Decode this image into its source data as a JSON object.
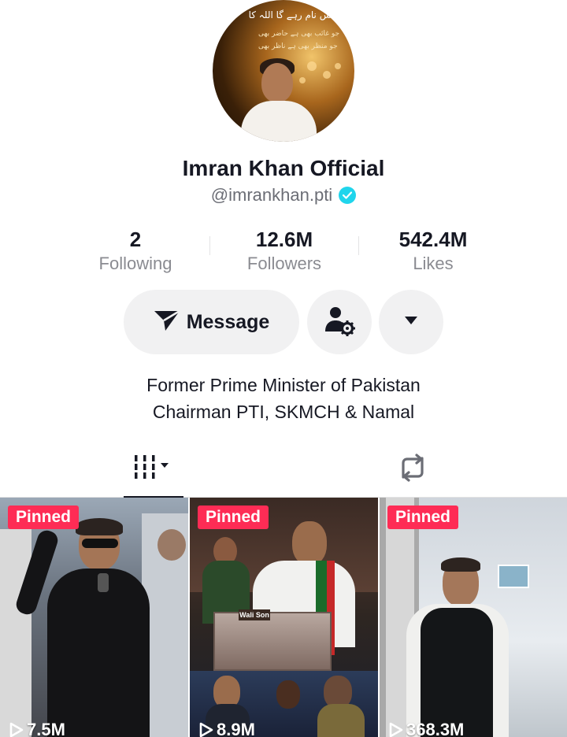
{
  "profile": {
    "avatar_text": {
      "line1": "بس نام رہے گا اللہ کا",
      "line2": "جو غائب بھی ہے حاضر بھی",
      "line3": "جو منظر بھی ہے ناظر بھی"
    },
    "name": "Imran Khan Official",
    "handle": "@imrankhan.pti",
    "verified": true
  },
  "stats": {
    "following": {
      "value": "2",
      "label": "Following"
    },
    "followers": {
      "value": "12.6M",
      "label": "Followers"
    },
    "likes": {
      "value": "542.4M",
      "label": "Likes"
    }
  },
  "actions": {
    "message_label": "Message",
    "message_icon": "send-icon",
    "add_friend_icon": "person-settings-icon",
    "more_icon": "caret-down-icon"
  },
  "bio": {
    "line1": "Former Prime Minister of Pakistan",
    "line2": "Chairman PTI, SKMCH & Namal"
  },
  "tabs": [
    {
      "name": "videos",
      "icon": "grid-icon",
      "active": true
    },
    {
      "name": "reposts",
      "icon": "repost-icon",
      "active": false
    }
  ],
  "videos": [
    {
      "pinned_label": "Pinned",
      "views": "7.5M",
      "sign_text": ""
    },
    {
      "pinned_label": "Pinned",
      "views": "8.9M",
      "sign_text": "Wali Son"
    },
    {
      "pinned_label": "Pinned",
      "views": "368.3M",
      "sign_text": ""
    }
  ],
  "colors": {
    "accent_pink": "#fe2c55",
    "verified_blue": "#20d5ec",
    "text_primary": "#161823",
    "text_secondary": "#8a8b91",
    "button_bg": "#f1f1f2"
  }
}
